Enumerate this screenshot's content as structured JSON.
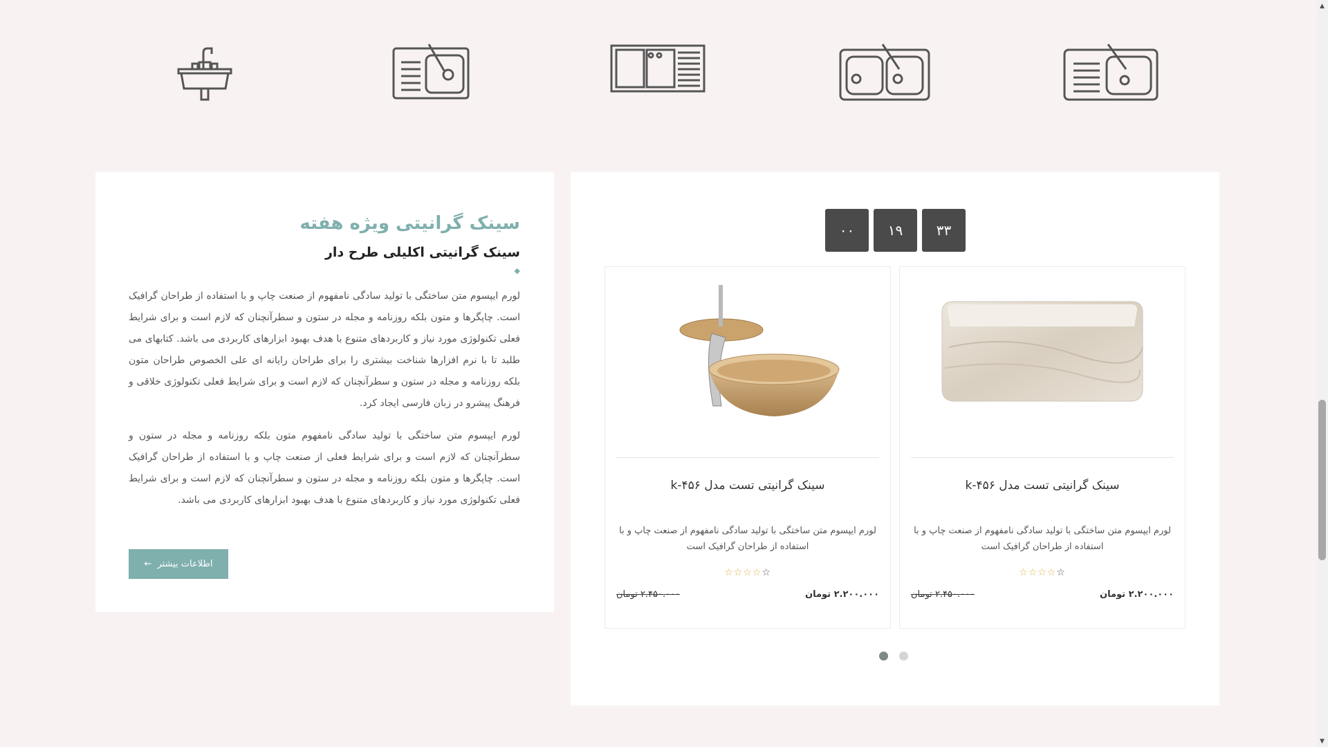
{
  "categories": [
    {
      "name": "washbasin"
    },
    {
      "name": "single-bowl-sink-with-drainer"
    },
    {
      "name": "double-bowl-sink-flat"
    },
    {
      "name": "double-bowl-sink"
    },
    {
      "name": "sink-with-drainer-round"
    }
  ],
  "weekly_special": {
    "title": "سینک گرانیتی ویژه هفته",
    "subtitle": "سینک گرانیتی اکلیلی طرح دار",
    "paragraphs": [
      "لورم ایپسوم متن ساختگی با تولید سادگی نامفهوم از صنعت چاپ و با استفاده از طراحان گرافیک است. چاپگرها و متون بلکه روزنامه و مجله در ستون و سطرآنچنان که لازم است و برای شرایط فعلی تکنولوژی مورد نیاز و کاربردهای متنوع با هدف بهبود ابزارهای کاربردی می باشد. کتابهای می طلبد تا با نرم افزارها شناخت بیشتری را برای طراحان رایانه ای علی الخصوص طراحان متون بلکه روزنامه و مجله در ستون و سطرآنچنان که لازم است و برای شرایط فعلی تکنولوژی خلاقی و فرهنگ پیشرو در زبان فارسی ایجاد کرد.",
      "لورم ایپسوم متن ساختگی با تولید سادگی نامفهوم متون بلکه روزنامه و مجله در ستون و سطرآنچنان که لازم است و برای شرایط فعلی از صنعت چاپ و با استفاده از طراحان گرافیک است. چاپگرها و متون بلکه روزنامه و مجله در ستون و سطرآنچنان که لازم است و برای شرایط فعلی تکنولوژی مورد نیاز و کاربردهای متنوع با هدف بهبود ابزارهای کاربردی می باشد."
    ],
    "button_label": "اطلاعات بیشتر",
    "button_arrow": "←"
  },
  "countdown": [
    "۰۰",
    "۱۹",
    "۳۳"
  ],
  "products": [
    {
      "title": "سینک گرانیتی تست مدل k-۴۵۶",
      "description": "لورم ایپسوم متن ساختگی با تولید سادگی نامفهوم از صنعت چاپ و با استفاده از طراحان گرافیک است",
      "rating": 4,
      "rating_max": 5,
      "price": "۲.۲۰۰.۰۰۰ تومان",
      "old_price": "۲.۴۵۰.۰۰۰ تومان",
      "image": "stone-trough-sink"
    },
    {
      "title": "سینک گرانیتی تست مدل k-۴۵۶",
      "description": "لورم ایپسوم متن ساختگی با تولید سادگی نامفهوم از صنعت چاپ و با استفاده از طراحان گرافیک است",
      "rating": 4,
      "rating_max": 5,
      "price": "۲.۲۰۰.۰۰۰ تومان",
      "old_price": "۲.۴۵۰.۰۰۰ تومان",
      "image": "vessel-sink-with-faucet"
    }
  ],
  "pagination": {
    "pages": 2,
    "active": 1
  },
  "colors": {
    "accent": "#7fb0ad",
    "countdown_bg": "#4a4a4a",
    "page_bg": "#f8f3f2",
    "star": "#e0b54a"
  }
}
